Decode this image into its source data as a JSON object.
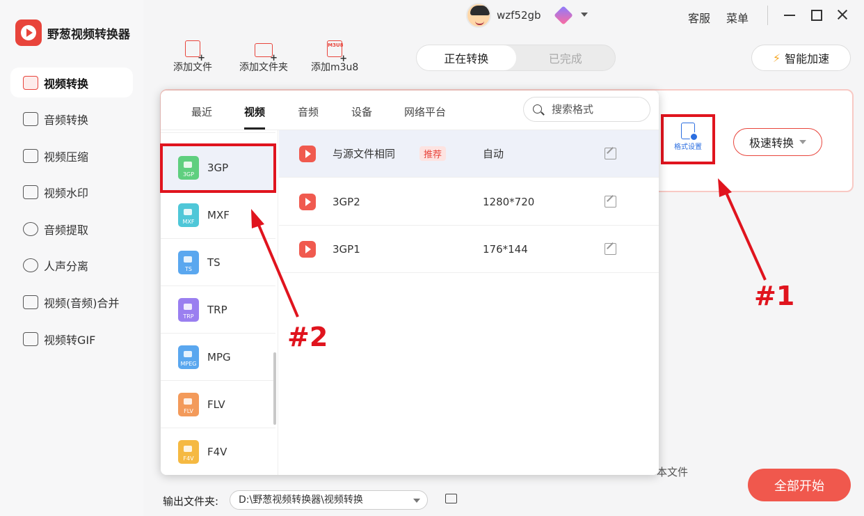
{
  "app": {
    "name": "野葱视频转换器"
  },
  "user": {
    "name": "wzf52gb"
  },
  "top_links": {
    "service": "客服",
    "menu": "菜单"
  },
  "sidebar": {
    "items": [
      {
        "label": "视频转换",
        "active": true
      },
      {
        "label": "音频转换"
      },
      {
        "label": "视频压缩"
      },
      {
        "label": "视频水印"
      },
      {
        "label": "音频提取"
      },
      {
        "label": "人声分离"
      },
      {
        "label": "视频(音频)合并"
      },
      {
        "label": "视频转GIF"
      }
    ]
  },
  "toolbar": {
    "add_file": "添加文件",
    "add_folder": "添加文件夹",
    "add_m3u8": "添加m3u8",
    "m3u8_icon": "M3U8"
  },
  "status_tabs": {
    "converting": "正在转换",
    "done": "已完成"
  },
  "boost": "智能加速",
  "file_card": {
    "format_settings": "格式设置",
    "speed_convert": "极速转换"
  },
  "popup": {
    "tabs": [
      "最近",
      "视频",
      "音频",
      "设备",
      "网络平台"
    ],
    "active_tab": "视频",
    "search_placeholder": "搜索格式",
    "formats": [
      {
        "name": "3GP",
        "tag": "3GP",
        "color": "#5fcf7f",
        "selected": true
      },
      {
        "name": "MXF",
        "tag": "MXF",
        "color": "#4fc7d8"
      },
      {
        "name": "TS",
        "tag": "TS",
        "color": "#5aa7ef"
      },
      {
        "name": "TRP",
        "tag": "TRP",
        "color": "#9a7ff0"
      },
      {
        "name": "MPG",
        "tag": "MPEG",
        "color": "#5aa7ef"
      },
      {
        "name": "FLV",
        "tag": "FLV",
        "color": "#f39a5a"
      },
      {
        "name": "F4V",
        "tag": "F4V",
        "color": "#f5b942"
      }
    ],
    "resolutions": [
      {
        "name": "与源文件相同",
        "badge": "推荐",
        "value": "自动"
      },
      {
        "name": "3GP2",
        "value": "1280*720"
      },
      {
        "name": "3GP1",
        "value": "176*144"
      }
    ]
  },
  "bottom": {
    "output_folder_label": "输出文件夹:",
    "output_folder_path": "D:\\野葱视频转换器\\视频转换",
    "partial_text": "本文件",
    "start_all": "全部开始"
  },
  "annotations": {
    "one": "#1",
    "two": "#2"
  },
  "colors": {
    "accent": "#e8443b",
    "annotation": "#e0141e",
    "link_blue": "#2b6ee0"
  }
}
